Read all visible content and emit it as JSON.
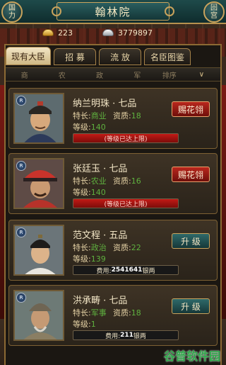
{
  "header": {
    "left_button": [
      "国",
      "力"
    ],
    "title": "翰林院",
    "right_button": [
      "回",
      "宫"
    ]
  },
  "currency": {
    "gold": "223",
    "silver": "3779897"
  },
  "tabs": [
    {
      "label": "现有大臣",
      "active": true
    },
    {
      "label": "招 募",
      "active": false
    },
    {
      "label": "流 放",
      "active": false
    },
    {
      "label": "名臣图鉴",
      "active": false
    }
  ],
  "sort": {
    "columns": [
      "商",
      "农",
      "政",
      "军"
    ],
    "sort_label": "排序"
  },
  "ministers": [
    {
      "name": "纳兰明珠 · 七品",
      "spec_label": "特长:",
      "spec": "商业",
      "apt_label": "资质:",
      "aptitude": "18",
      "level_label": "等级:",
      "level": "140",
      "bar_text": "(等级已达上限)",
      "button": "赐花翎",
      "button_style": "red"
    },
    {
      "name": "张廷玉 · 七品",
      "spec_label": "特长:",
      "spec": "农业",
      "apt_label": "资质:",
      "aptitude": "16",
      "level_label": "等级:",
      "level": "140",
      "bar_text": "(等级已达上限)",
      "button": "赐花翎",
      "button_style": "red"
    },
    {
      "name": "范文程 · 五品",
      "spec_label": "特长:",
      "spec": "政治",
      "apt_label": "资质:",
      "aptitude": "22",
      "level_label": "等级:",
      "level": "139",
      "cost_prefix": "费用:",
      "cost_value": "2541641",
      "cost_unit": "银两",
      "button": "升 级",
      "button_style": "teal"
    },
    {
      "name": "洪承畴 · 七品",
      "spec_label": "特长:",
      "spec": "军事",
      "apt_label": "资质:",
      "aptitude": "18",
      "level_label": "等级:",
      "level": "1",
      "cost_prefix": "费用:",
      "cost_value": "211",
      "cost_unit": "银两",
      "button": "升 级",
      "button_style": "teal"
    }
  ],
  "watermark": "谷普软件园",
  "colors": {
    "accent_gold": "#c9a35c",
    "value_green": "#5fb03f",
    "button_red": "#b9271d",
    "button_teal": "#2f6a6a"
  }
}
